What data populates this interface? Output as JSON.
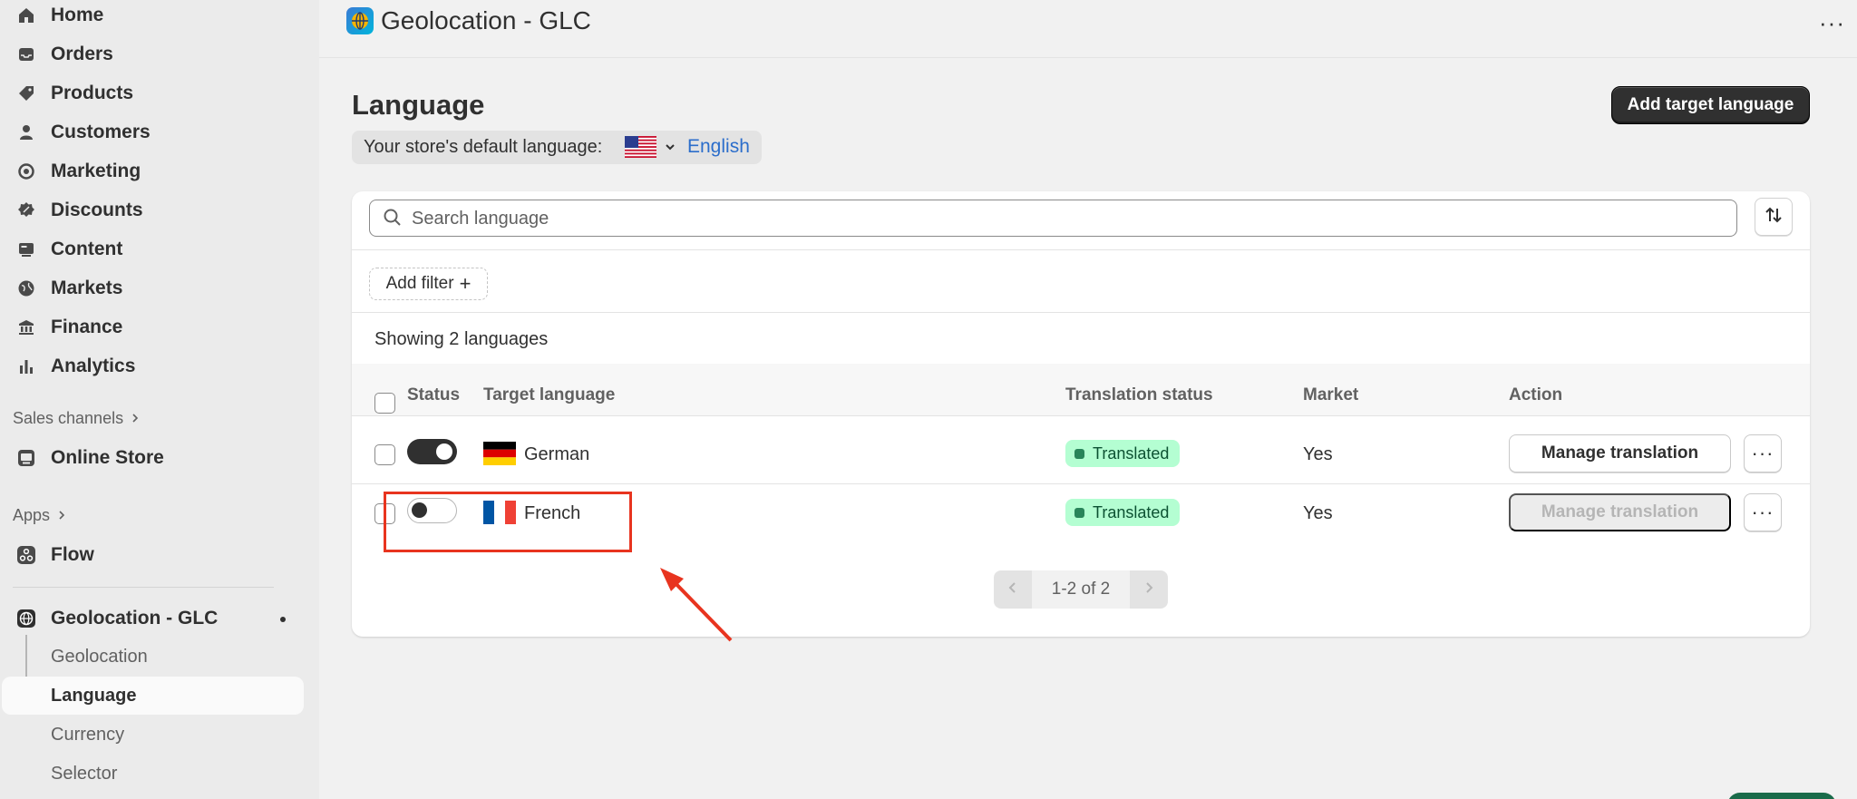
{
  "sidebar": {
    "items": [
      {
        "label": "Home",
        "icon": "home-icon"
      },
      {
        "label": "Orders",
        "icon": "inbox-icon"
      },
      {
        "label": "Products",
        "icon": "tag-icon"
      },
      {
        "label": "Customers",
        "icon": "person-icon"
      },
      {
        "label": "Marketing",
        "icon": "target-icon"
      },
      {
        "label": "Discounts",
        "icon": "discount-icon"
      },
      {
        "label": "Content",
        "icon": "content-icon"
      },
      {
        "label": "Markets",
        "icon": "globe-icon"
      },
      {
        "label": "Finance",
        "icon": "bank-icon"
      },
      {
        "label": "Analytics",
        "icon": "bar-chart-icon"
      }
    ],
    "sales_channels_label": "Sales channels",
    "online_store_label": "Online Store",
    "apps_label": "Apps",
    "flow_label": "Flow",
    "app_name": "Geolocation - GLC",
    "app_subitems": [
      "Geolocation",
      "Language",
      "Currency",
      "Selector"
    ]
  },
  "header": {
    "app_title": "Geolocation - GLC",
    "more_label": "···"
  },
  "page": {
    "title": "Language",
    "add_button": "Add target language",
    "default_language_label": "Your store's default language:",
    "default_language_value": "English"
  },
  "search": {
    "placeholder": "Search language",
    "value": ""
  },
  "filter": {
    "add_label": "Add filter",
    "plus": "+"
  },
  "list": {
    "showing_text": "Showing 2 languages",
    "columns": {
      "status": "Status",
      "target_language": "Target language",
      "translation_status": "Translation status",
      "market": "Market",
      "action": "Action"
    },
    "rows": [
      {
        "language": "German",
        "enabled": true,
        "translation_status": "Translated",
        "market": "Yes",
        "action": "Manage translation",
        "action_enabled": true
      },
      {
        "language": "French",
        "enabled": false,
        "translation_status": "Translated",
        "market": "Yes",
        "action": "Manage translation",
        "action_enabled": false
      }
    ],
    "more_label": "···"
  },
  "pagination": {
    "text": "1-2 of 2"
  },
  "colors": {
    "accent_link": "#2c6ecb",
    "primary_button": "#303030",
    "badge_bg": "#b4fed2",
    "annotation": "#e8341f"
  }
}
